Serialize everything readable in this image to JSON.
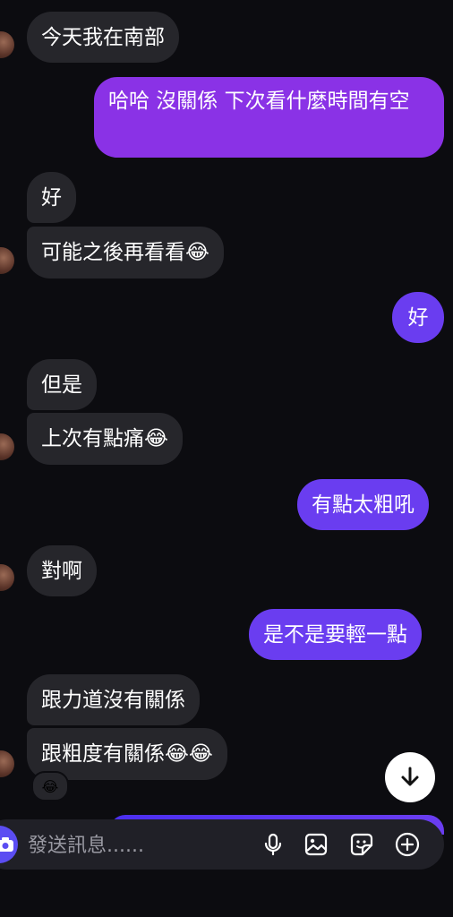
{
  "messages": [
    {
      "text": "今天我在南部"
    },
    {
      "text": "哈哈 沒關係 下次看什麼時間有空"
    },
    {
      "text": "好"
    },
    {
      "text": "可能之後再看看😂"
    },
    {
      "text": "好"
    },
    {
      "text": "但是"
    },
    {
      "text": "上次有點痛😂"
    },
    {
      "text": "有點太粗吼"
    },
    {
      "text": "對啊"
    },
    {
      "text": "是不是要輕一點"
    },
    {
      "text": "跟力道沒有關係"
    },
    {
      "text": "跟粗度有關係😂😂"
    }
  ],
  "reaction": {
    "emoji": "😂"
  },
  "composer": {
    "placeholder": "發送訊息......"
  },
  "icons": [
    "camera-icon",
    "microphone-icon",
    "image-icon",
    "sticker-icon",
    "plus-icon",
    "arrow-down-icon"
  ],
  "colors": {
    "background": "#0c0c10",
    "incoming_bubble": "#26262b",
    "outgoing_bubble": "#6a3df0",
    "outgoing_bubble_top": "#8a32e6"
  }
}
